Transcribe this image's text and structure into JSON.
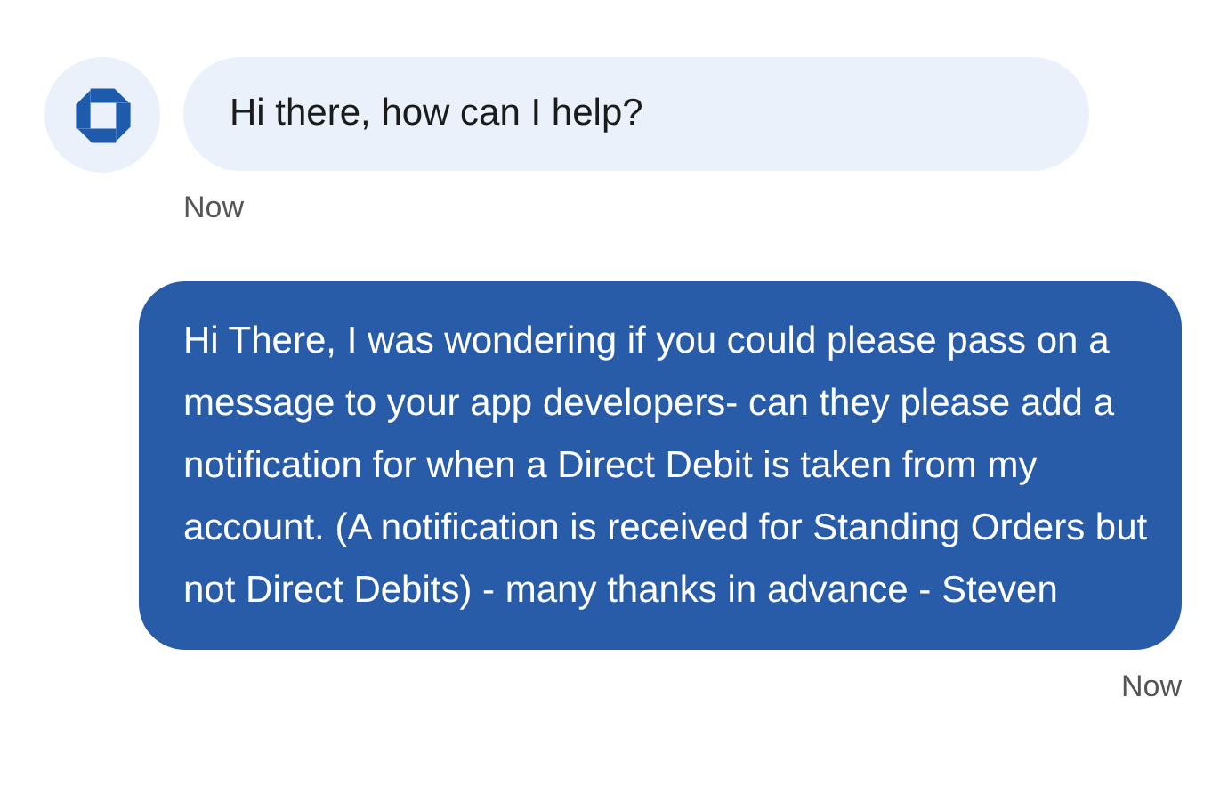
{
  "messages": [
    {
      "kind": "agent",
      "text": "Hi there, how can I help?",
      "time": "Now"
    },
    {
      "kind": "user",
      "text": "Hi There, I was wondering if you could please pass on a message to your app developers- can they please add a notification for when a Direct Debit is taken from my account. (A notification is received for Standing Orders but not Direct Debits) - many thanks in advance - Steven",
      "time": "Now"
    }
  ]
}
